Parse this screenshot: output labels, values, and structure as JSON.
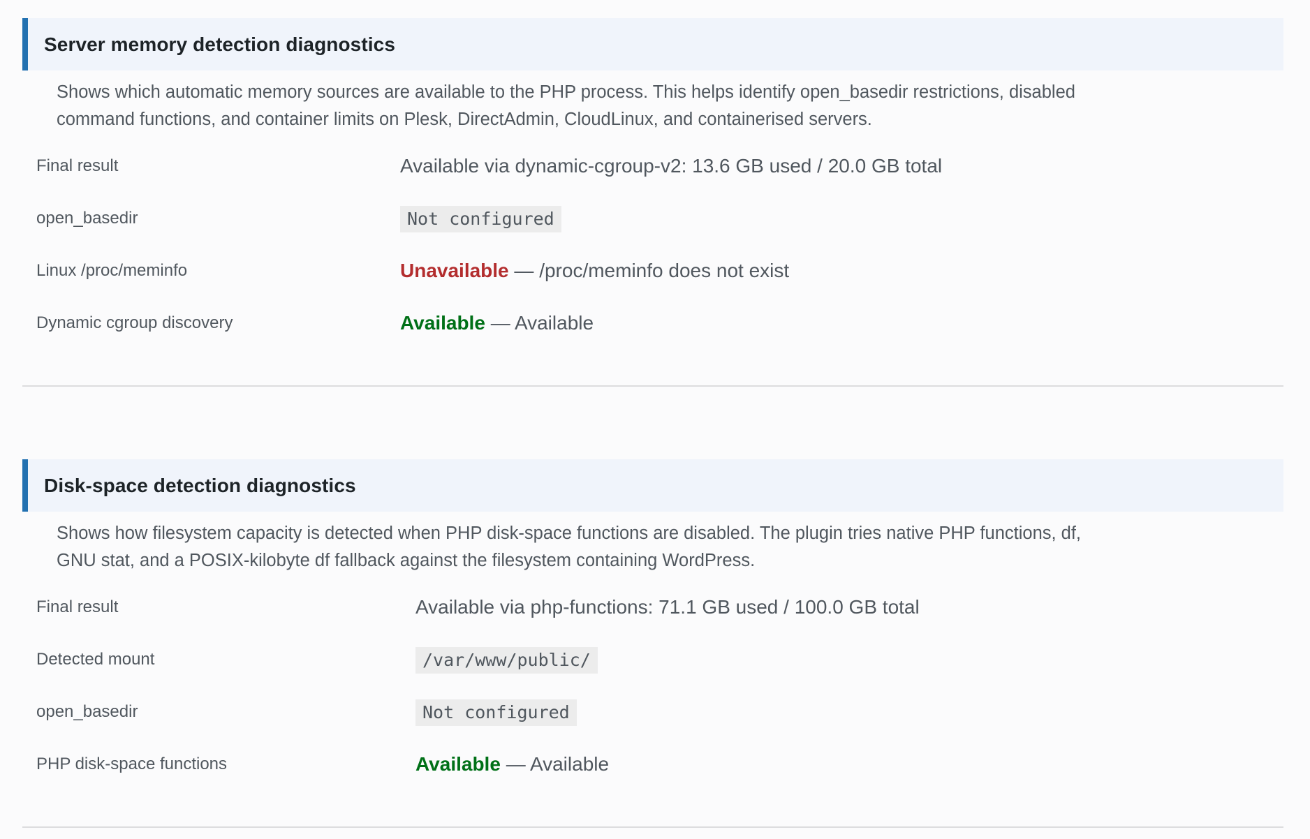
{
  "memory": {
    "title": "Server memory detection diagnostics",
    "description": "Shows which automatic memory sources are available to the PHP process. This helps identify open_basedir restrictions, disabled command functions, and container limits on Plesk, DirectAdmin, CloudLinux, and containerised servers.",
    "rows": [
      {
        "label": "Final result",
        "value": "Available via dynamic-cgroup-v2: 13.6 GB used / 20.0 GB total"
      },
      {
        "label": "open_basedir",
        "value": "Not configured"
      },
      {
        "label": "Linux /proc/meminfo",
        "status": "Unavailable",
        "separator": " — ",
        "detail": "/proc/meminfo does not exist"
      },
      {
        "label": "Dynamic cgroup discovery",
        "status": "Available",
        "separator": " — ",
        "detail": "Available"
      }
    ]
  },
  "disk": {
    "title": "Disk-space detection diagnostics",
    "description": "Shows how filesystem capacity is detected when PHP disk-space functions are disabled. The plugin tries native PHP functions, df, GNU stat, and a POSIX-kilobyte df fallback against the filesystem containing WordPress.",
    "rows": [
      {
        "label": "Final result",
        "value": "Available via php-functions: 71.1 GB used / 100.0 GB total"
      },
      {
        "label": "Detected mount",
        "value": "/var/www/public/"
      },
      {
        "label": "open_basedir",
        "value": "Not configured"
      },
      {
        "label": "PHP disk-space functions",
        "status": "Available",
        "separator": " — ",
        "detail": "Available"
      }
    ]
  },
  "colors": {
    "accent": "#2271b1",
    "header_bg": "#f0f4fb",
    "unavailable": "#b32d2e",
    "available": "#007017"
  }
}
